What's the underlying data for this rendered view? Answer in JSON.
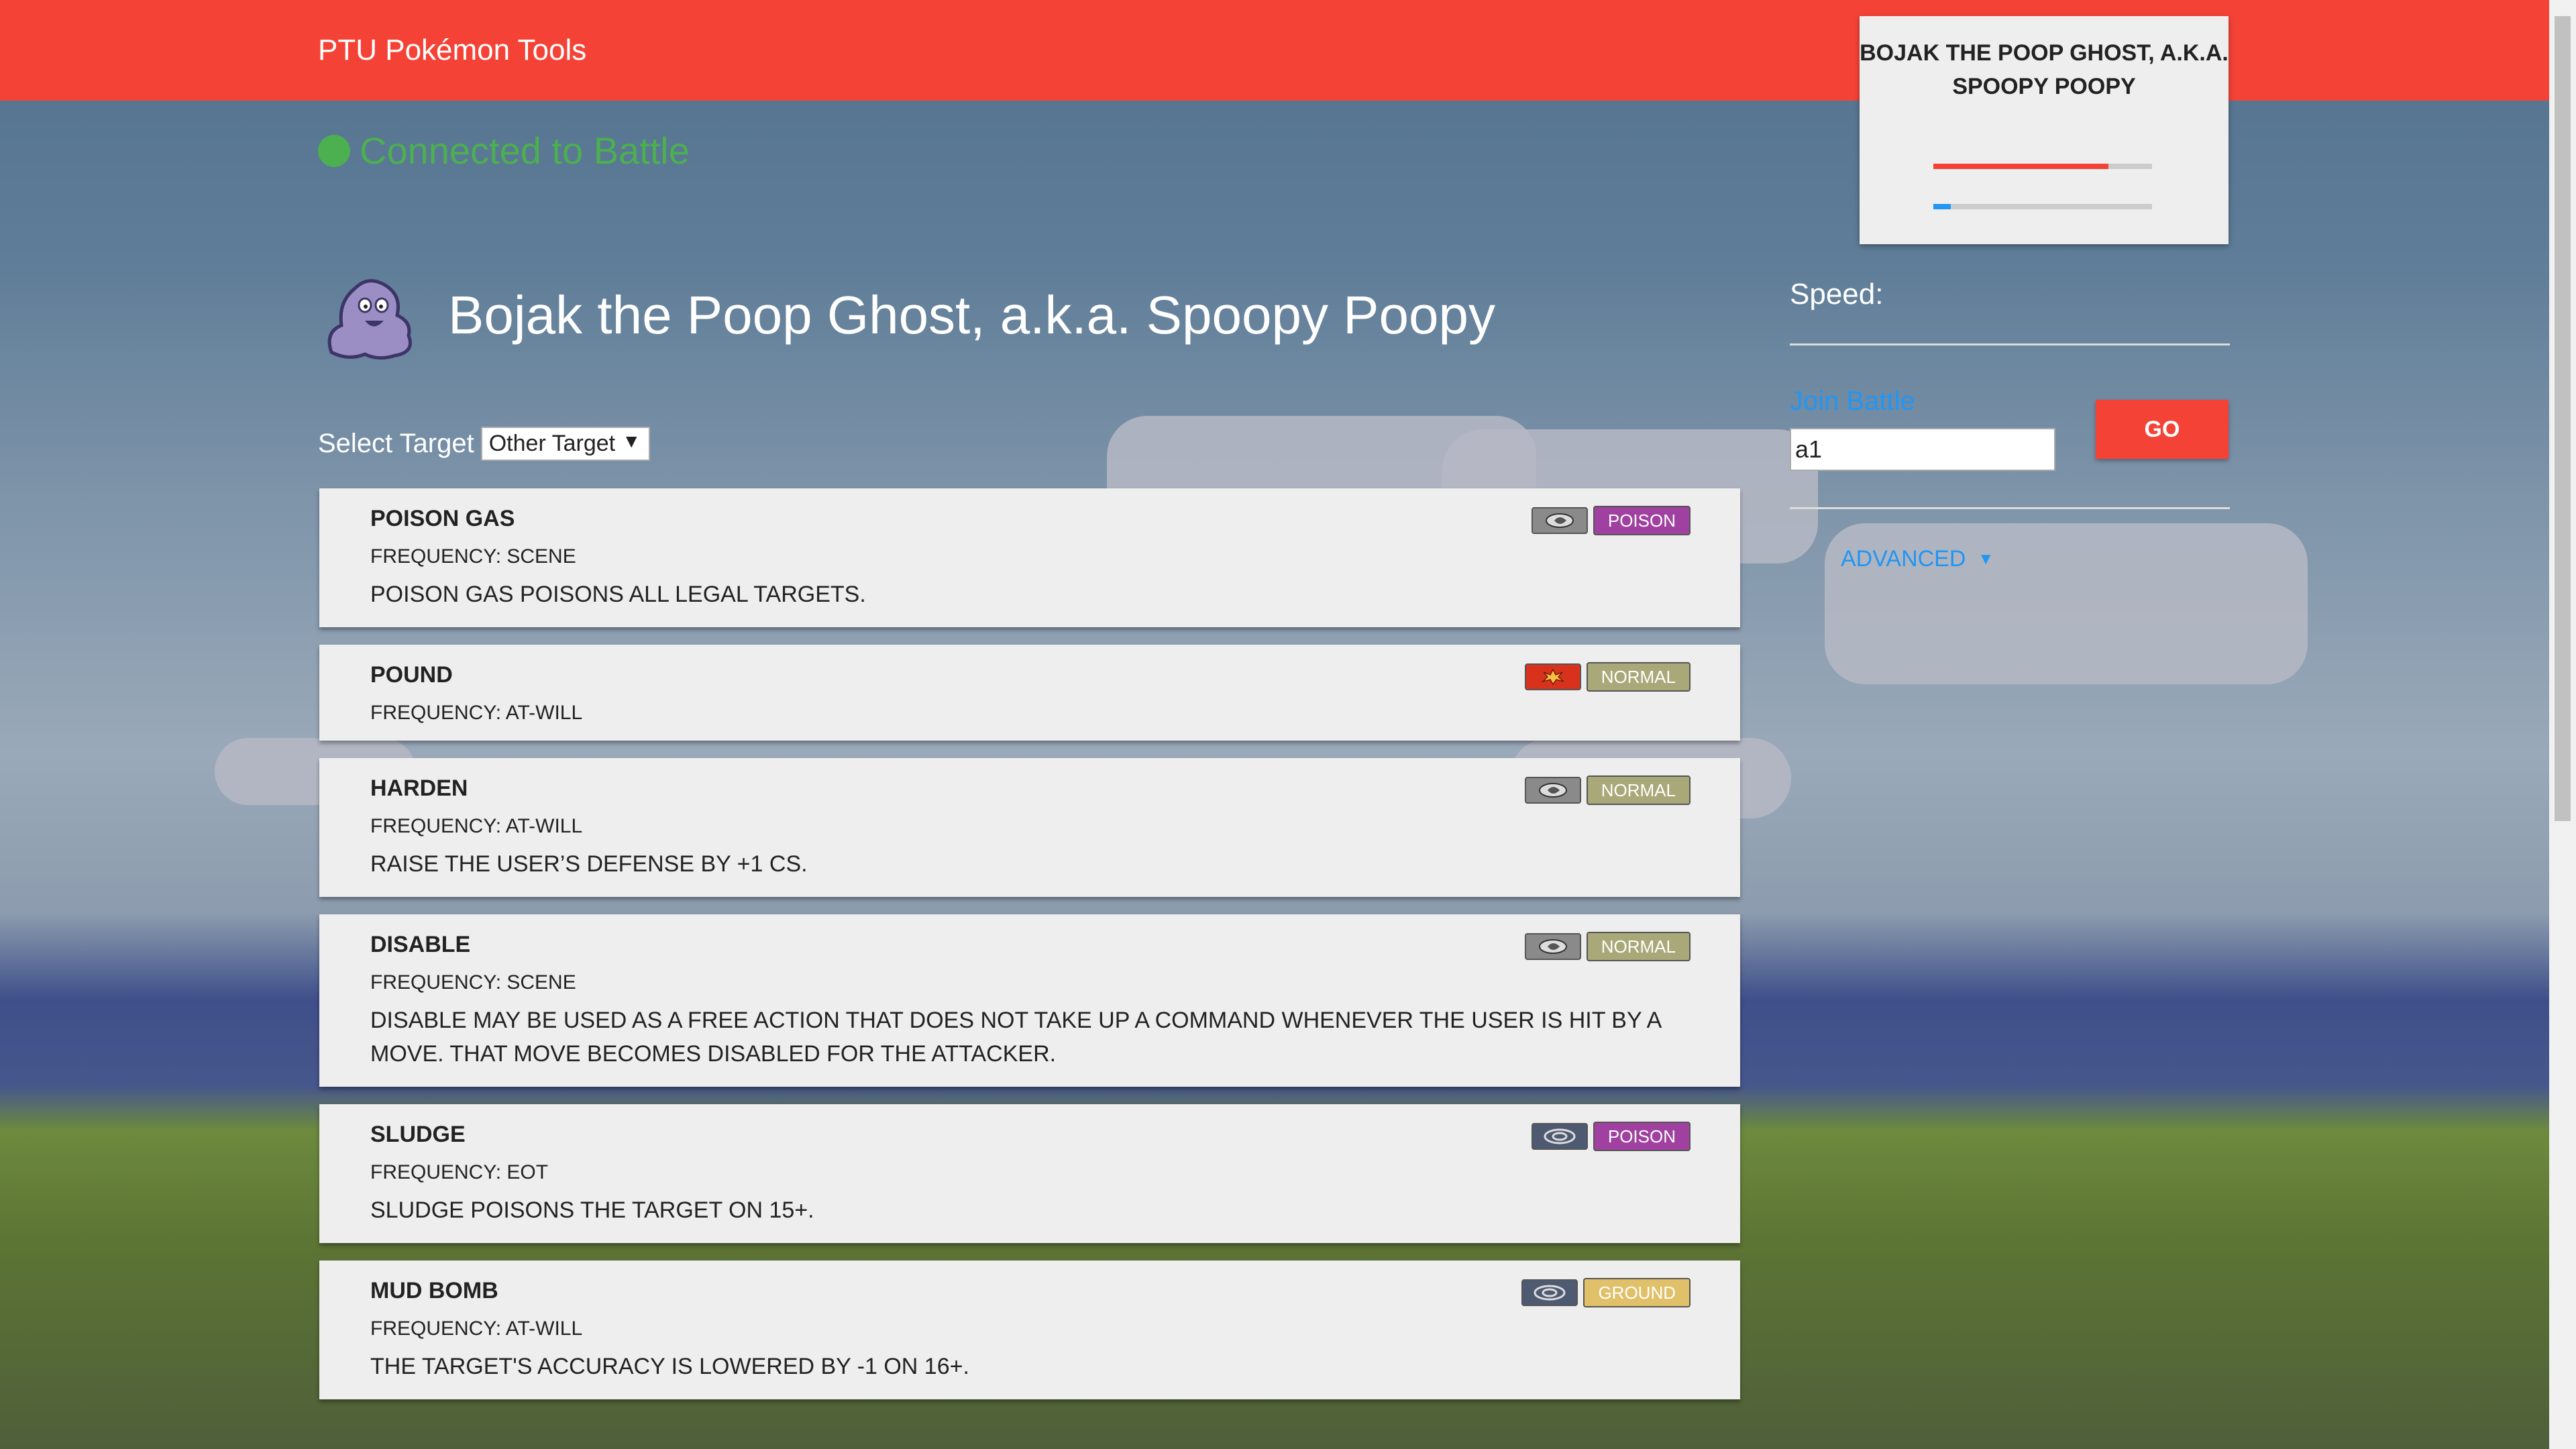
{
  "header": {
    "brand": "PTU Pokémon Tools"
  },
  "status": {
    "text": "Connected to Battle",
    "color": "#4caf50"
  },
  "pokemon": {
    "name": "Bojak the Poop Ghost, a.k.a. Spoopy Poopy"
  },
  "target": {
    "label": "Select Target",
    "selected": "Other Target"
  },
  "moves": [
    {
      "name": "POISON GAS",
      "frequency": "FREQUENCY: SCENE",
      "description": "POISON GAS POISONS ALL LEGAL TARGETS.",
      "category": "status-icon",
      "type": "POISON",
      "type_color": "#a040a0"
    },
    {
      "name": "POUND",
      "frequency": "FREQUENCY: AT-WILL",
      "description": "",
      "category": "physical-icon",
      "type": "NORMAL",
      "type_color": "#a8a878"
    },
    {
      "name": "HARDEN",
      "frequency": "FREQUENCY: AT-WILL",
      "description": "RAISE THE USER’S DEFENSE BY +1 CS.",
      "category": "status-icon",
      "type": "NORMAL",
      "type_color": "#a8a878"
    },
    {
      "name": "DISABLE",
      "frequency": "FREQUENCY: SCENE",
      "description": "DISABLE MAY BE USED AS A FREE ACTION THAT DOES NOT TAKE UP A COMMAND WHENEVER THE USER IS HIT BY A MOVE. THAT MOVE BECOMES DISABLED FOR THE ATTACKER.",
      "category": "status-icon",
      "type": "NORMAL",
      "type_color": "#a8a878"
    },
    {
      "name": "SLUDGE",
      "frequency": "FREQUENCY: EOT",
      "description": "SLUDGE POISONS THE TARGET ON 15+.",
      "category": "special-icon",
      "type": "POISON",
      "type_color": "#a040a0"
    },
    {
      "name": "MUD BOMB",
      "frequency": "FREQUENCY: AT-WILL",
      "description": "THE TARGET'S ACCURACY IS LOWERED BY -1 ON 16+.",
      "category": "special-icon",
      "type": "GROUND",
      "type_color": "#e0c068"
    }
  ],
  "sidecard": {
    "name": "BOJAK THE POOP GHOST, A.K.A. SPOOPY POOPY",
    "hp_fraction": 0.8,
    "hp_color": "#f44336",
    "exp_fraction": 0.08,
    "exp_color": "#2196f3"
  },
  "sidebar": {
    "speed_label": "Speed:",
    "join_label": "Join Battle",
    "join_value": "a1",
    "go_label": "GO",
    "advanced_label": "ADVANCED"
  }
}
